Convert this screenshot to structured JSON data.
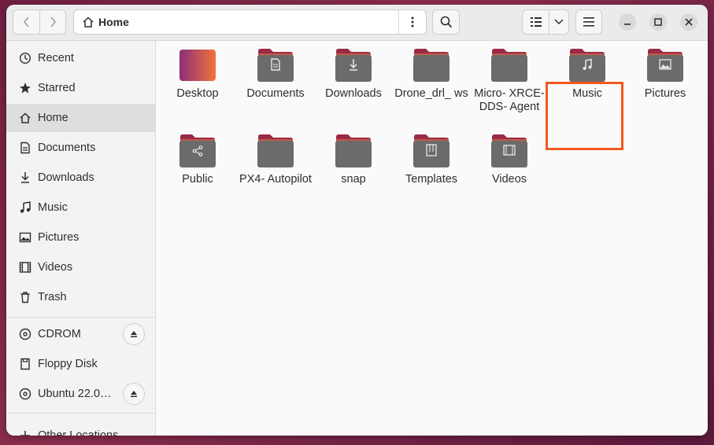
{
  "window": {
    "title": "Home"
  },
  "pathbar": {
    "location": "Home"
  },
  "sidebar": {
    "places": [
      {
        "label": "Recent",
        "icon": "clock-icon"
      },
      {
        "label": "Starred",
        "icon": "star-icon"
      },
      {
        "label": "Home",
        "icon": "home-icon"
      },
      {
        "label": "Documents",
        "icon": "document-icon"
      },
      {
        "label": "Downloads",
        "icon": "download-icon"
      },
      {
        "label": "Music",
        "icon": "music-icon"
      },
      {
        "label": "Pictures",
        "icon": "picture-icon"
      },
      {
        "label": "Videos",
        "icon": "video-icon"
      },
      {
        "label": "Trash",
        "icon": "trash-icon"
      }
    ],
    "devices": [
      {
        "label": "CDROM",
        "icon": "disc-icon",
        "eject": true
      },
      {
        "label": "Floppy Disk",
        "icon": "floppy-icon",
        "eject": false
      },
      {
        "label": "Ubuntu 22.0…",
        "icon": "disc-icon",
        "eject": true
      }
    ],
    "other": {
      "label": "Other Locations",
      "icon": "plus-icon"
    },
    "active": "Home"
  },
  "files": [
    {
      "name": "Desktop",
      "type": "desktop"
    },
    {
      "name": "Documents",
      "type": "documents"
    },
    {
      "name": "Downloads",
      "type": "downloads"
    },
    {
      "name": "Drone_drl_ ws",
      "type": "folder",
      "highlighted": true
    },
    {
      "name": "Micro- XRCE-DDS- Agent",
      "type": "folder"
    },
    {
      "name": "Music",
      "type": "music"
    },
    {
      "name": "Pictures",
      "type": "pictures"
    },
    {
      "name": "Public",
      "type": "public"
    },
    {
      "name": "PX4- Autopilot",
      "type": "folder"
    },
    {
      "name": "snap",
      "type": "folder"
    },
    {
      "name": "Templates",
      "type": "templates"
    },
    {
      "name": "Videos",
      "type": "videos"
    }
  ],
  "colors": {
    "accent_highlight": "#f2591d",
    "folder_body": "#6b6b6b",
    "folder_tab": "#9b2b45"
  }
}
